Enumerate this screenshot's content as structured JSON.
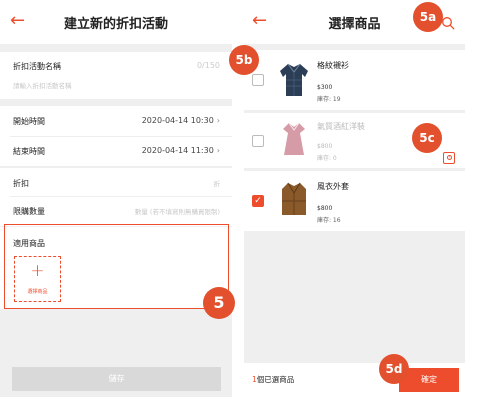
{
  "left": {
    "header": {
      "back_icon": "←",
      "title": "建立新的折扣活動"
    },
    "name_field": {
      "label": "折扣活動名稱",
      "counter": "0/150",
      "placeholder": "請輸入折扣活動名稱"
    },
    "start": {
      "label": "開始時間",
      "value": "2020-04-14 10:30"
    },
    "end": {
      "label": "結束時間",
      "value": "2020-04-14 11:30"
    },
    "discount": {
      "label": "折扣",
      "placeholder": "折"
    },
    "limit": {
      "label": "限購數量",
      "placeholder": "數量 (若不填寫則無購買限制)"
    },
    "products": {
      "label": "適用商品",
      "add_icon": "+",
      "add_label": "選擇商品"
    },
    "save_label": "儲存"
  },
  "right": {
    "header": {
      "back_icon": "←",
      "title": "選擇商品",
      "search_icon": "search-icon"
    },
    "items": [
      {
        "name": "格紋襯衫",
        "price": "$300",
        "stock": "庫存: 19",
        "checked": false,
        "disabled": false
      },
      {
        "name": "氣質酒紅洋裝",
        "price": "$800",
        "stock": "庫存: 0",
        "checked": false,
        "disabled": true
      },
      {
        "name": "風衣外套",
        "price": "$800",
        "stock": "庫存: 16",
        "checked": true,
        "disabled": false
      }
    ],
    "footer": {
      "selected_count": "1",
      "selected_suffix": "個已選商品",
      "confirm_label": "確定"
    }
  },
  "callouts": {
    "c5": "5",
    "c5a": "5a",
    "c5b": "5b",
    "c5c": "5c",
    "c5d": "5d"
  },
  "colors": {
    "accent": "#ee4d2d",
    "callout": "#e2502d",
    "disabled_button": "#d9d9d9"
  }
}
